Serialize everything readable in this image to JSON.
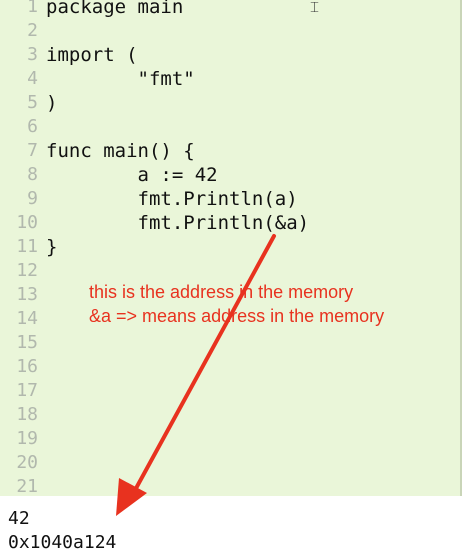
{
  "editor": {
    "lines": [
      {
        "num": "1",
        "text": "package main"
      },
      {
        "num": "2",
        "text": ""
      },
      {
        "num": "3",
        "text": "import ("
      },
      {
        "num": "4",
        "text": "        \"fmt\""
      },
      {
        "num": "5",
        "text": ")"
      },
      {
        "num": "6",
        "text": ""
      },
      {
        "num": "7",
        "text": "func main() {"
      },
      {
        "num": "8",
        "text": "        a := 42"
      },
      {
        "num": "9",
        "text": "        fmt.Println(a)"
      },
      {
        "num": "10",
        "text": "        fmt.Println(&a)"
      },
      {
        "num": "11",
        "text": "}"
      },
      {
        "num": "12",
        "text": ""
      },
      {
        "num": "13",
        "text": ""
      },
      {
        "num": "14",
        "text": ""
      },
      {
        "num": "15",
        "text": ""
      },
      {
        "num": "16",
        "text": ""
      },
      {
        "num": "17",
        "text": ""
      },
      {
        "num": "18",
        "text": ""
      },
      {
        "num": "19",
        "text": ""
      },
      {
        "num": "20",
        "text": ""
      },
      {
        "num": "21",
        "text": ""
      }
    ]
  },
  "annotations": {
    "line1": "this is the address in the memory",
    "line2": "&a => means address in the memory",
    "color": "#e8321f"
  },
  "output": {
    "line1": "42",
    "line2": "0x1040a124"
  },
  "colors": {
    "editor_bg": "#eaf6d9",
    "line_number": "#b1b8ad",
    "arrow": "#e8321f"
  },
  "icons": {
    "cursor": "text-cursor-icon"
  }
}
